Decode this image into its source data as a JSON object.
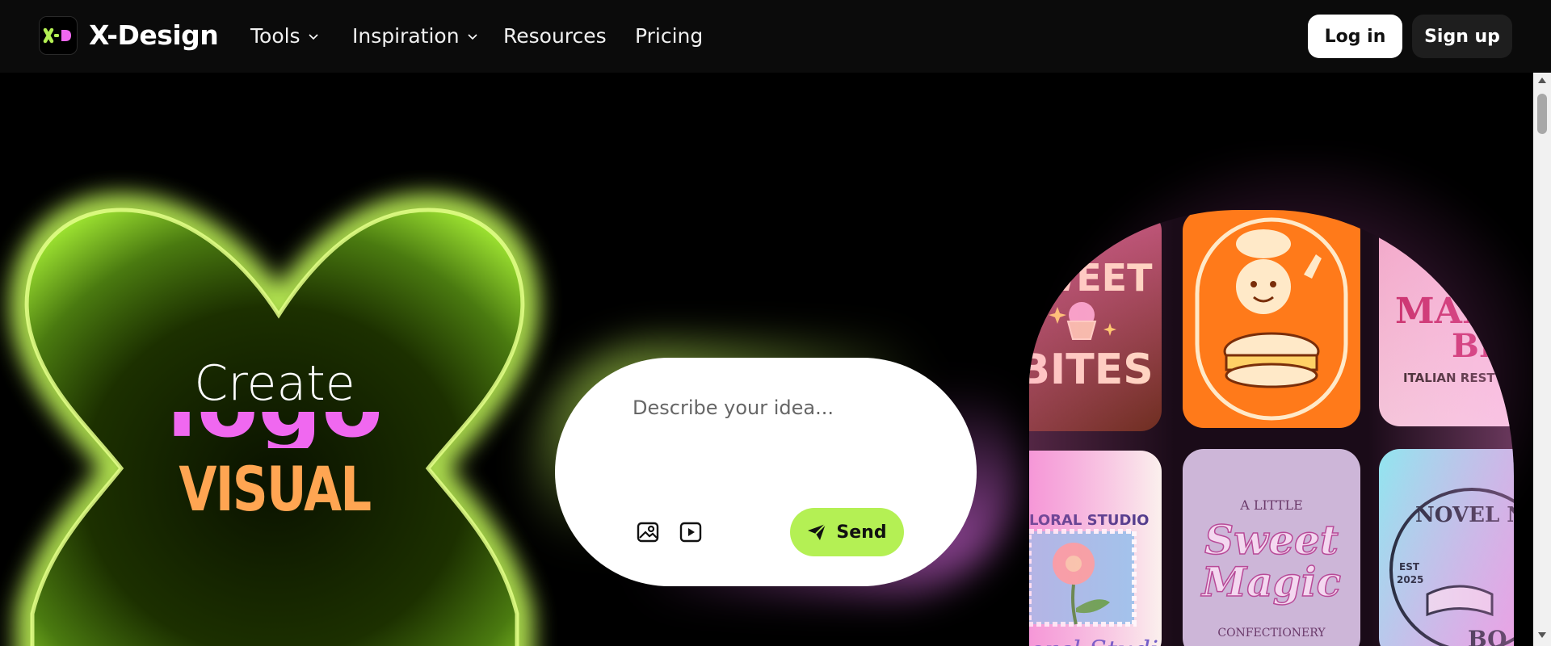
{
  "nav": {
    "brand": "X-Design",
    "logo_glyph": "X-D",
    "items": [
      {
        "label": "Tools",
        "has_dropdown": true
      },
      {
        "label": "Inspiration",
        "has_dropdown": true
      },
      {
        "label": "Resources",
        "has_dropdown": false
      },
      {
        "label": "Pricing",
        "has_dropdown": false
      }
    ],
    "login_label": "Log in",
    "signup_label": "Sign up"
  },
  "hero": {
    "create": "Create",
    "highlight_word": "logo",
    "visual": "VISUAL"
  },
  "prompt": {
    "placeholder": "Describe your idea...",
    "send_label": "Send",
    "icons": [
      "image-upload-icon",
      "video-icon",
      "send-icon"
    ]
  },
  "gallery": {
    "tiles": [
      {
        "name": "sweet-bites",
        "line1": "WEET",
        "line2": "BITES"
      },
      {
        "name": "chef-burger",
        "line1": "",
        "line2": ""
      },
      {
        "name": "mango-bros",
        "line1": "MANG",
        "line2": "BR",
        "sub": "ITALIAN REST"
      },
      {
        "name": "floral-studio",
        "line1": "LORAL STUDIO",
        "line2": "oral Studio"
      },
      {
        "name": "sweet-magic",
        "top": "A LITTLE",
        "line1": "Sweet",
        "line2": "Magic",
        "sub": "CONFECTIONERY"
      },
      {
        "name": "novel-nest",
        "line1": "NOVEL NE",
        "est": "EST",
        "year": "2025",
        "line2": "BO"
      }
    ]
  },
  "colors": {
    "accent_green": "#b4f054",
    "accent_pink": "#f068f0",
    "accent_orange": "#ffa552",
    "nav_bg": "#0b0b0b"
  }
}
